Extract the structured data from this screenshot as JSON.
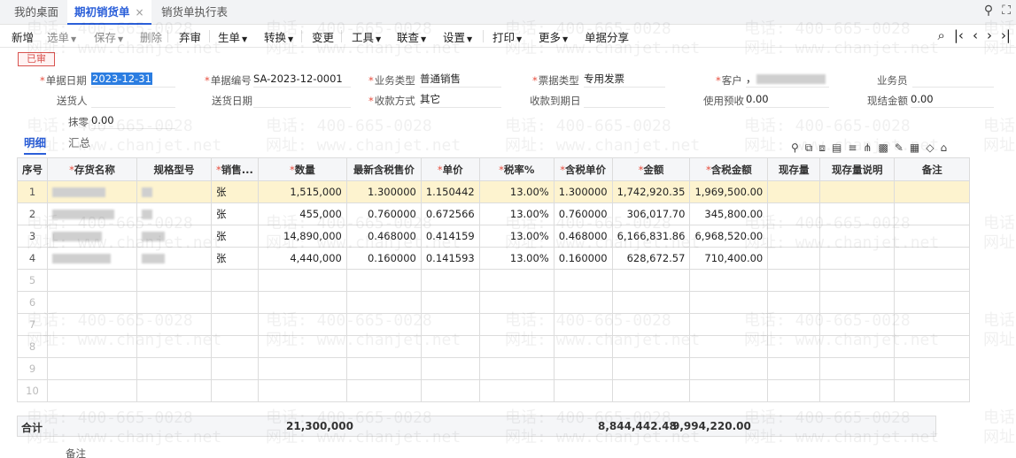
{
  "tabs": [
    {
      "label": "我的桌面"
    },
    {
      "label": "期初销货单",
      "close": "×"
    },
    {
      "label": "销货单执行表"
    }
  ],
  "toolbar": {
    "items": [
      {
        "label": "新增",
        "caret": false,
        "disabled": false
      },
      {
        "label": "选单",
        "caret": true,
        "disabled": true
      },
      {
        "label": "保存",
        "caret": true,
        "disabled": true
      },
      {
        "label": "删除",
        "caret": false,
        "disabled": true
      },
      {
        "label": "弃审",
        "caret": false,
        "disabled": false
      },
      {
        "label": "生单",
        "caret": true,
        "disabled": false
      },
      {
        "label": "转换",
        "caret": true,
        "disabled": false
      },
      {
        "label": "变更",
        "caret": false,
        "disabled": false
      },
      {
        "label": "工具",
        "caret": true,
        "disabled": false
      },
      {
        "label": "联查",
        "caret": true,
        "disabled": false
      },
      {
        "label": "设置",
        "caret": true,
        "disabled": false
      },
      {
        "label": "打印",
        "caret": true,
        "disabled": false
      },
      {
        "label": "更多",
        "caret": true,
        "disabled": false
      },
      {
        "label": "单据分享",
        "caret": false,
        "disabled": false
      }
    ]
  },
  "status_stamp": "已审",
  "form": {
    "doc_date_label": "单据日期",
    "doc_date": "2023-12-31",
    "doc_no_label": "单据编号",
    "doc_no": "SA-2023-12-0001",
    "biz_type_label": "业务类型",
    "biz_type": "普通销售",
    "invoice_type_label": "票据类型",
    "invoice_type": "专用发票",
    "customer_label": "客户",
    "customer_prefix": "，",
    "salesman_label": "业务员",
    "deliverer_label": "送货人",
    "delivery_date_label": "送货日期",
    "pay_method_label": "收款方式",
    "pay_method": "其它",
    "due_date_label": "收款到期日",
    "prepay_label": "使用预收",
    "prepay": "0.00",
    "cash_label": "现结金额",
    "cash": "0.00",
    "round_label": "抹零",
    "round": "0.00"
  },
  "subtabs": [
    "明细",
    "汇总"
  ],
  "table": {
    "headers": [
      {
        "label": "序号",
        "req": false
      },
      {
        "label": "存货名称",
        "req": true
      },
      {
        "label": "规格型号",
        "req": false
      },
      {
        "label": "销售...",
        "req": true
      },
      {
        "label": "数量",
        "req": true
      },
      {
        "label": "最新含税售价",
        "req": false
      },
      {
        "label": "单价",
        "req": true
      },
      {
        "label": "税率%",
        "req": true
      },
      {
        "label": "含税单价",
        "req": true
      },
      {
        "label": "金额",
        "req": true
      },
      {
        "label": "含税金额",
        "req": true
      },
      {
        "label": "现存量",
        "req": false
      },
      {
        "label": "现存量说明",
        "req": false
      },
      {
        "label": "备注",
        "req": false
      }
    ],
    "rows": [
      {
        "idx": "1",
        "name": "",
        "spec": "",
        "unit": "张",
        "qty": "1,515,000",
        "latest_price": "1.300000",
        "price": "1.150442",
        "tax_rate": "13.00%",
        "tax_price": "1.300000",
        "amount": "1,742,920.35",
        "tax_amount": "1,969,500.00"
      },
      {
        "idx": "2",
        "name": "",
        "spec": "",
        "unit": "张",
        "qty": "455,000",
        "latest_price": "0.760000",
        "price": "0.672566",
        "tax_rate": "13.00%",
        "tax_price": "0.760000",
        "amount": "306,017.70",
        "tax_amount": "345,800.00"
      },
      {
        "idx": "3",
        "name": "",
        "spec": "",
        "unit": "张",
        "qty": "14,890,000",
        "latest_price": "0.468000",
        "price": "0.414159",
        "tax_rate": "13.00%",
        "tax_price": "0.468000",
        "amount": "6,166,831.86",
        "tax_amount": "6,968,520.00"
      },
      {
        "idx": "4",
        "name": "",
        "spec": "",
        "unit": "张",
        "qty": "4,440,000",
        "latest_price": "0.160000",
        "price": "0.141593",
        "tax_rate": "13.00%",
        "tax_price": "0.160000",
        "amount": "628,672.57",
        "tax_amount": "710,400.00"
      }
    ],
    "empty_rows": [
      "5",
      "6",
      "7",
      "8",
      "9",
      "10"
    ]
  },
  "totals": {
    "label": "合计",
    "qty": "21,300,000",
    "amount": "8,844,442.48",
    "tax_amount": "9,994,220.00"
  },
  "remark_label": "备注",
  "watermark": {
    "phone": "电话: 400-665-0028",
    "site": "网址: www.chanjet.net"
  }
}
